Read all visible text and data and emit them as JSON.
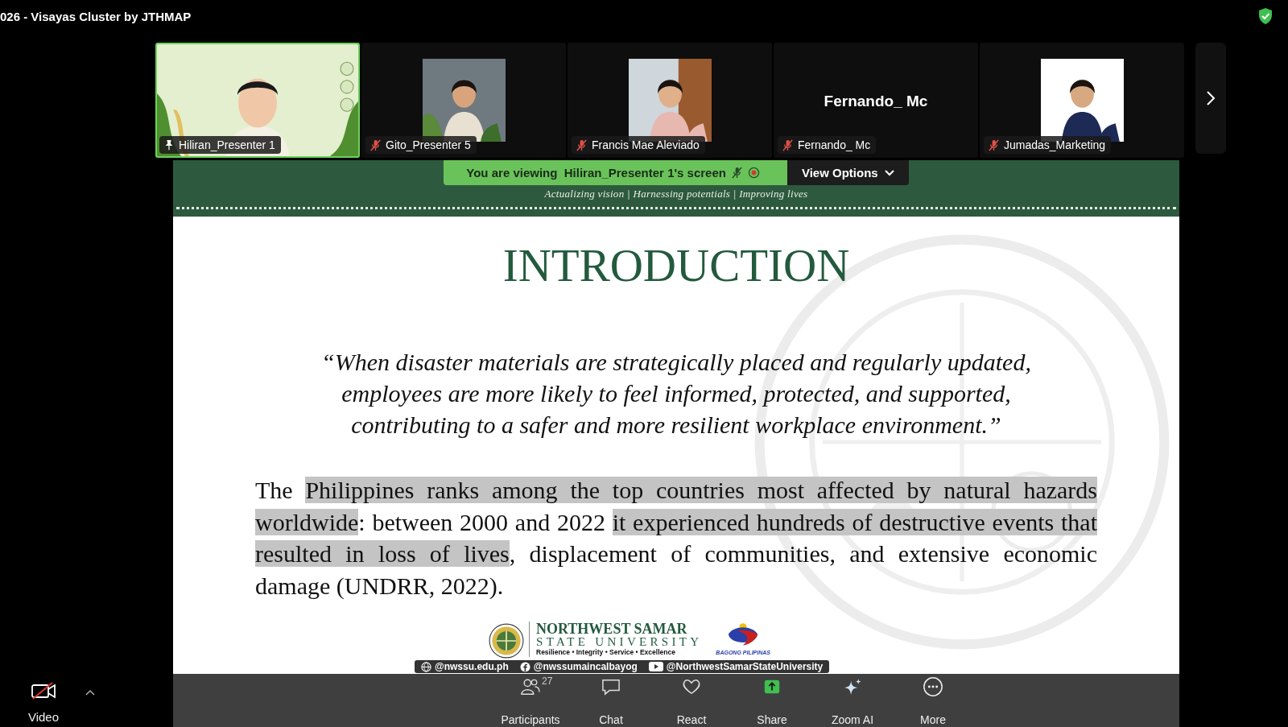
{
  "window": {
    "title": "026 - Visayas Cluster by JTHMAP"
  },
  "participants": [
    {
      "name": "Hiliran_Presenter 1",
      "video": true,
      "active": true,
      "pinned": true,
      "muted": false
    },
    {
      "name": "Gito_Presenter 5",
      "video": true,
      "active": false,
      "pinned": false,
      "muted": true
    },
    {
      "name": "Francis Mae Aleviado",
      "video": true,
      "active": false,
      "pinned": false,
      "muted": true
    },
    {
      "name": "Fernando_ Mc",
      "display_name": "Fernando_ Mc",
      "video": false,
      "active": false,
      "pinned": false,
      "muted": true
    },
    {
      "name": "Jumadas_Marketing",
      "video": true,
      "active": false,
      "pinned": false,
      "muted": true
    }
  ],
  "share_banner": {
    "text": "You are viewing  Hiliran_Presenter 1's screen",
    "button": "View Options"
  },
  "slide": {
    "tagline": "Actualizing vision | Harnessing potentials | Improving lives",
    "title": "INTRODUCTION",
    "quote_lines": [
      "“When disaster materials are strategically placed and regularly updated,",
      "employees are more likely to feel informed, protected, and supported,",
      "contributing to a safer and more resilient workplace environment.”"
    ],
    "paragraph": [
      {
        "text": "The ",
        "highlighted": false
      },
      {
        "text": "Philippines ranks among the top countries most affected by natural hazards worldwide",
        "highlighted": true
      },
      {
        "text": ": between 2000 and 2022 ",
        "highlighted": false
      },
      {
        "text": "it experienced hundreds of destructive events that resulted in loss of lives",
        "highlighted": true
      },
      {
        "text": ", displacement of communities, and extensive economic damage (UNDRR, 2022).",
        "highlighted": false
      }
    ],
    "footer": {
      "university_line_1": "NORTHWEST SAMAR",
      "university_line_2": "STATE UNIVERSITY",
      "motto": "Resilience • Integrity • Service • Excellence",
      "badge": "BAGONG PILIPINAS",
      "socials": [
        {
          "kind": "web",
          "handle": "@nwssu.edu.ph"
        },
        {
          "kind": "facebook",
          "handle": "@nwssumaincalbayog"
        },
        {
          "kind": "youtube",
          "handle": "@NorthwestSamarStateUniversity"
        }
      ]
    }
  },
  "toolbar": {
    "video": {
      "label": "Video",
      "off": true
    },
    "items": [
      {
        "kind": "participants",
        "label": "Participants",
        "count": "27"
      },
      {
        "kind": "chat",
        "label": "Chat"
      },
      {
        "kind": "react",
        "label": "React"
      },
      {
        "kind": "share",
        "label": "Share"
      },
      {
        "kind": "ai",
        "label": "Zoom AI"
      },
      {
        "kind": "more",
        "label": "More"
      }
    ]
  }
}
